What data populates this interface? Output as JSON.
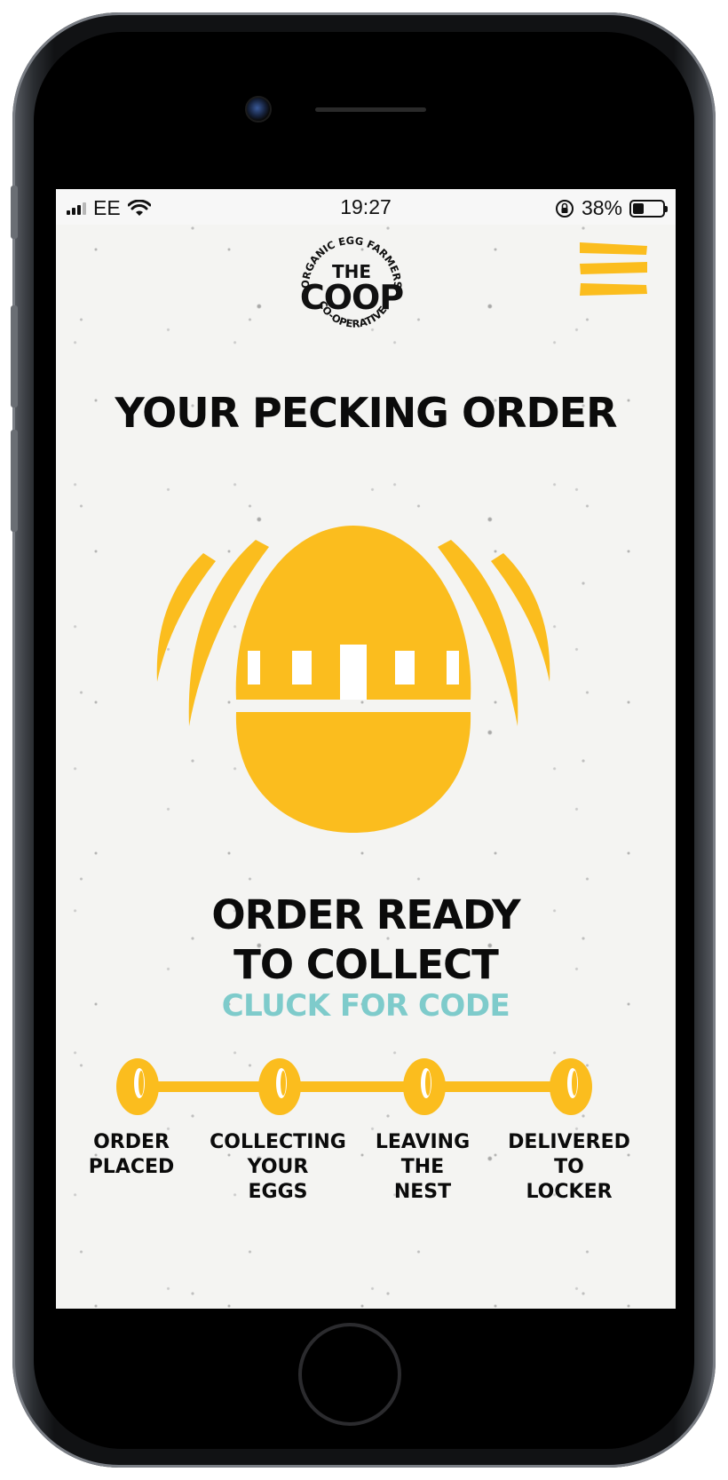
{
  "status_bar": {
    "carrier": "EE",
    "time": "19:27",
    "battery_percent": "38%",
    "battery_level": 0.38,
    "icons": [
      "signal-icon",
      "wifi-icon",
      "rotation-lock-icon",
      "battery-icon"
    ]
  },
  "header": {
    "logo": {
      "top_arc": "ORGANIC EGG FARMERS",
      "the": "THE",
      "main": "COOP",
      "bottom_arc": "CO-OPERATIVE"
    },
    "menu_icon": "hamburger-menu-icon"
  },
  "page": {
    "title": "YOUR PECKING ORDER"
  },
  "order_status": {
    "line1": "ORDER READY",
    "line2": "TO COLLECT",
    "code_link": "CLUCK FOR CODE"
  },
  "progress": {
    "current_step": 4,
    "steps": [
      {
        "label_lines": [
          "ORDER",
          "PLACED"
        ]
      },
      {
        "label_lines": [
          "COLLECTING",
          "YOUR",
          "EGGS"
        ]
      },
      {
        "label_lines": [
          "LEAVING",
          "THE",
          "NEST"
        ]
      },
      {
        "label_lines": [
          "DELIVERED",
          "TO",
          "LOCKER"
        ]
      }
    ]
  },
  "colors": {
    "accent_yellow": "#FBBD1E",
    "link_teal": "#7ECBCB",
    "text_black": "#0B0B0B",
    "background": "#F4F4F2"
  }
}
